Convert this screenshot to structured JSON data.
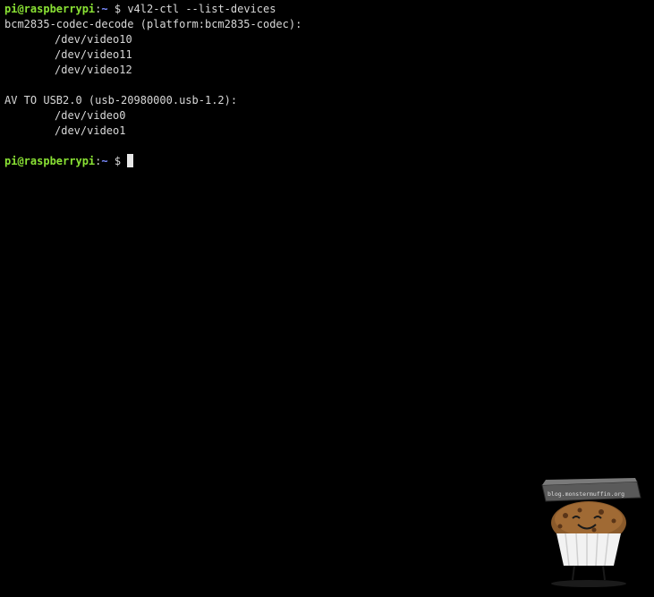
{
  "terminal": {
    "prompt1": {
      "user_host": "pi@raspberrypi",
      "colon": ":",
      "path": "~",
      "dollar": " $ ",
      "command": "v4l2-ctl --list-devices"
    },
    "device_groups": [
      {
        "header": "bcm2835-codec-decode (platform:bcm2835-codec):",
        "devices": [
          "/dev/video10",
          "/dev/video11",
          "/dev/video12"
        ]
      },
      {
        "header": "AV TO USB2.0 (usb-20980000.usb-1.2):",
        "devices": [
          "/dev/video0",
          "/dev/video1"
        ]
      }
    ],
    "prompt2": {
      "user_host": "pi@raspberrypi",
      "colon": ":",
      "path": "~",
      "dollar": " $ "
    }
  },
  "watermark": {
    "text": "blog.monstermuffin.org",
    "icon": "muffin-mascot-icon"
  },
  "colors": {
    "background": "#000000",
    "text": "#d8d8d8",
    "user_host": "#8ae234",
    "path": "#7b8cff"
  }
}
